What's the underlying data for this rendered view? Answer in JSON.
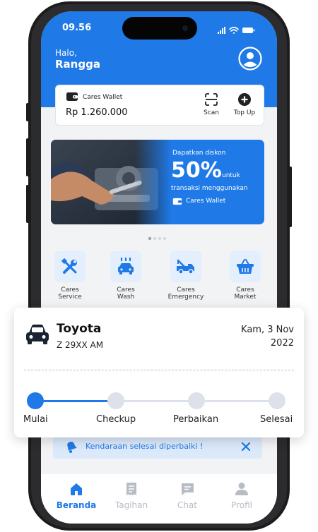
{
  "status_bar": {
    "time": "09.56"
  },
  "header": {
    "greeting": "Halo,",
    "name": "Rangga"
  },
  "wallet": {
    "title": "Cares Wallet",
    "balance": "Rp 1.260.000",
    "scan_label": "Scan",
    "topup_label": "Top Up"
  },
  "banner": {
    "line1": "Dapatkan diskon",
    "big": "50%",
    "small": "untuk",
    "line2": "transaksi menggunakan",
    "wallet_label": "Cares Wallet",
    "carousel_pages": 4,
    "carousel_active": 1
  },
  "services": [
    {
      "line1": "Cares",
      "line2": "Service",
      "icon": "tools-icon"
    },
    {
      "line1": "Cares",
      "line2": "Wash",
      "icon": "car-wash-icon"
    },
    {
      "line1": "Cares",
      "line2": "Emergency",
      "icon": "tow-truck-icon"
    },
    {
      "line1": "Cares",
      "line2": "Market",
      "icon": "basket-icon"
    }
  ],
  "order_card": {
    "vehicle": "Toyota",
    "plate": "Z 29XX AM",
    "date_line1": "Kam, 3 Nov",
    "date_line2": "2022",
    "steps": [
      "Mulai",
      "Checkup",
      "Perbaikan",
      "Selesai"
    ],
    "completed_steps": 1
  },
  "notification": {
    "text": "Kendaraan selesai diperbaiki !"
  },
  "nav": [
    {
      "label": "Beranda",
      "icon": "home-icon",
      "active": true
    },
    {
      "label": "Tagihan",
      "icon": "receipt-icon",
      "active": false
    },
    {
      "label": "Chat",
      "icon": "chat-icon",
      "active": false
    },
    {
      "label": "Profil",
      "icon": "profile-icon",
      "active": false
    }
  ],
  "colors": {
    "primary": "#1f79e6",
    "light_primary": "#e3effd",
    "inactive": "#b7bcc5"
  }
}
